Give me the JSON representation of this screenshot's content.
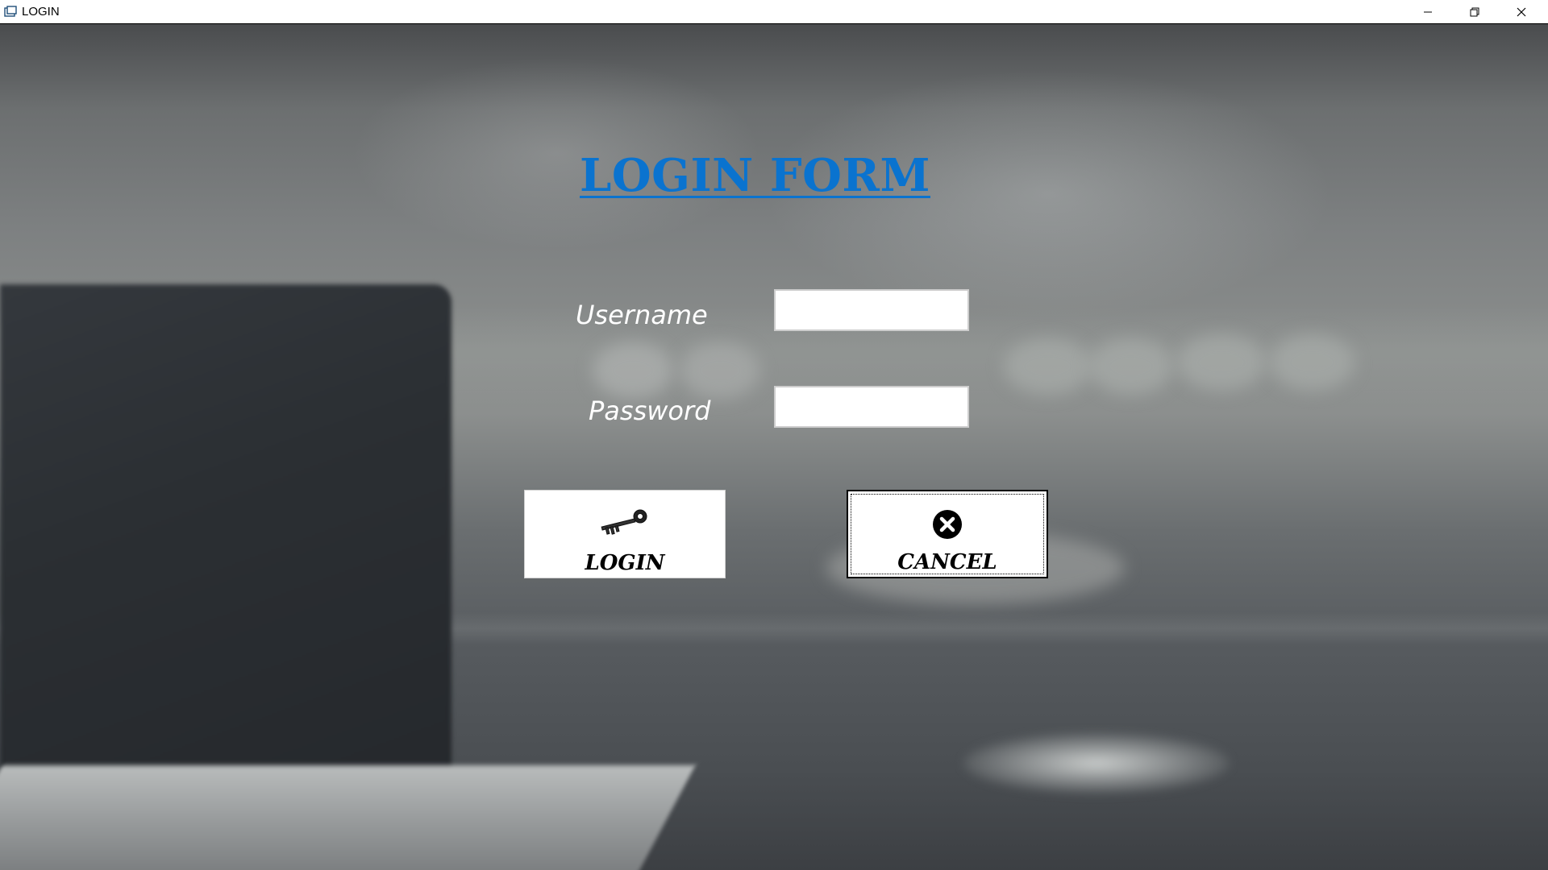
{
  "window": {
    "title": "LOGIN",
    "controls": {
      "minimize": "minimize",
      "restore": "restore",
      "close": "close"
    }
  },
  "form": {
    "title": "LOGIN FORM",
    "username": {
      "label": "Username",
      "value": "",
      "placeholder": ""
    },
    "password": {
      "label": "Password",
      "value": "",
      "placeholder": ""
    },
    "buttons": {
      "login": {
        "label": "LOGIN",
        "icon": "key-icon"
      },
      "cancel": {
        "label": "CANCEL",
        "icon": "close-circle-icon"
      }
    }
  },
  "colors": {
    "title": "#0a73cf",
    "label": "#ffffff",
    "button_bg": "#ffffff"
  }
}
